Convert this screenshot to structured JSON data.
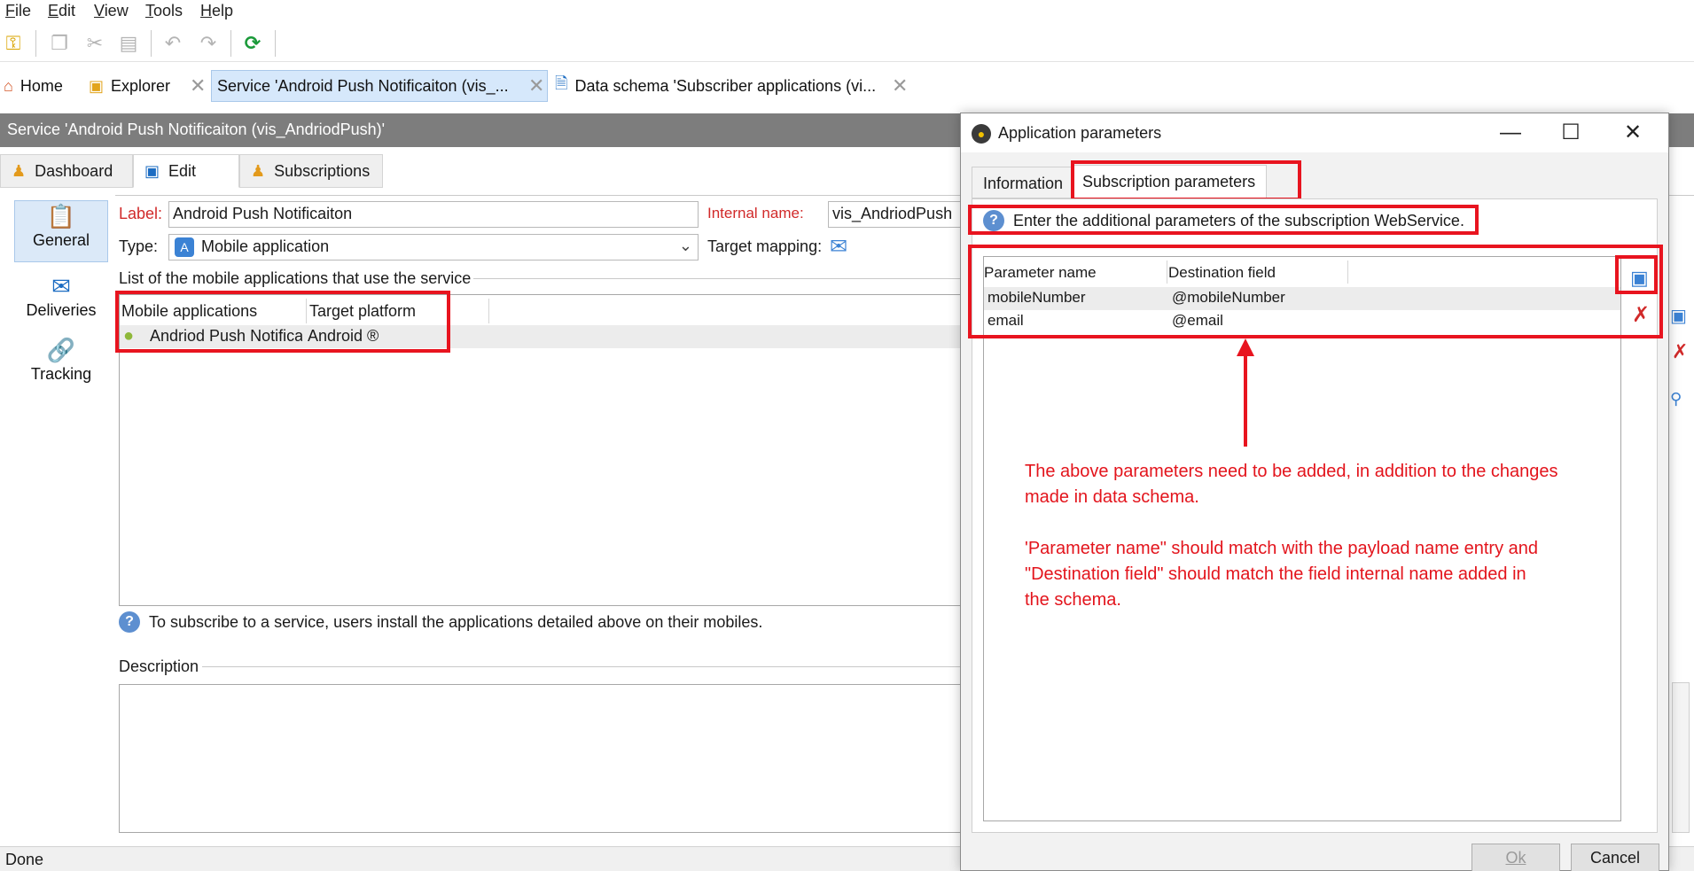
{
  "menu": [
    "File",
    "Edit",
    "View",
    "Tools",
    "Help"
  ],
  "toolbar": {
    "icons": [
      "key-icon",
      "copy-icon",
      "cut-icon",
      "paste-icon",
      "undo-icon",
      "redo-icon",
      "refresh-icon"
    ]
  },
  "tabs": {
    "home": "Home",
    "explorer": "Explorer",
    "service": "Service 'Android Push Notificaiton (vis_...",
    "schema": "Data schema 'Subscriber applications (vi..."
  },
  "service_title": "Service 'Android Push Notificaiton (vis_AndriodPush)'",
  "subtabs": {
    "dashboard": "Dashboard",
    "edit": "Edit",
    "subscriptions": "Subscriptions"
  },
  "leftnav": {
    "general": "General",
    "deliveries": "Deliveries",
    "tracking": "Tracking"
  },
  "form": {
    "label_caption": "Label:",
    "label_value": "Android Push Notificaiton",
    "internal_caption": "Internal name:",
    "internal_value": "vis_AndriodPush",
    "type_caption": "Type:",
    "type_value": "Mobile application",
    "target_mapping_caption": "Target mapping:",
    "list_caption": "List of the mobile applications that use the service",
    "apps_headers": [
      "Mobile applications",
      "Target platform"
    ],
    "apps_rows": [
      {
        "app": "Andriod Push Notifica",
        "platform": "Android ®"
      }
    ],
    "hint": "To subscribe to a service, users install the applications detailed above on their mobiles.",
    "description_caption": "Description"
  },
  "status": "Done",
  "dialog": {
    "title": "Application parameters",
    "tab_information": "Information",
    "tab_subscription": "Subscription parameters",
    "info_text": "Enter the additional parameters of the subscription WebService.",
    "headers": [
      "Parameter name",
      "Destination field"
    ],
    "rows": [
      {
        "name": "mobileNumber",
        "field": "@mobileNumber"
      },
      {
        "name": "email",
        "field": "@email"
      }
    ],
    "ok": "Ok",
    "cancel": "Cancel"
  },
  "annotation": {
    "line1": "The above parameters need to be added, in addition to the changes",
    "line2": "made in data schema.",
    "line3": "'Parameter name\" should match with the payload name entry and",
    "line4": "\"Destination field\" should match the field internal name added in",
    "line5": "the schema."
  },
  "colors": {
    "annotation_red": "#e8141f",
    "title_gray": "#7d7d7d",
    "accent_blue": "#1c6cc2"
  }
}
